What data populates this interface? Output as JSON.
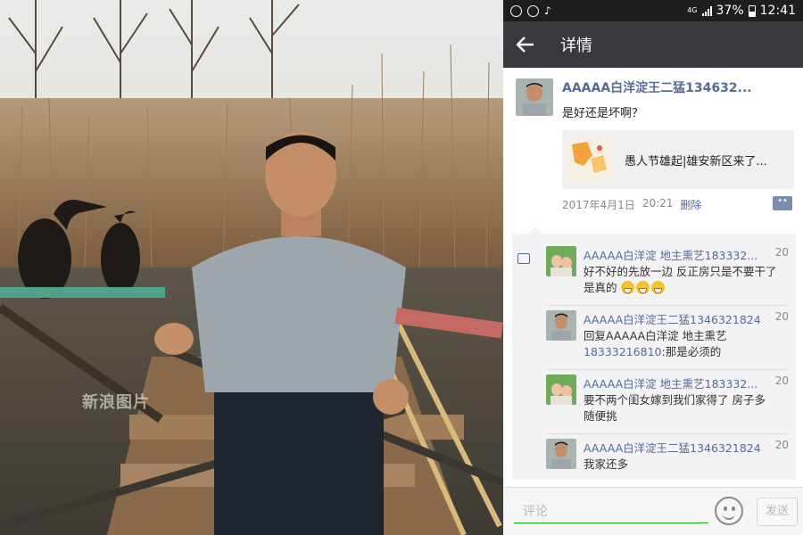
{
  "photo": {
    "watermark": "新浪图片"
  },
  "status_bar": {
    "left_icons": [
      "app-icon",
      "sync-icon",
      "tiktok-icon"
    ],
    "network": "4G",
    "battery": "37%",
    "time": "12:41"
  },
  "titlebar": {
    "back_icon": "back-arrow-icon",
    "title": "详情"
  },
  "post": {
    "username": "AAAAA白洋淀王二猛134632...",
    "text": "是好还是坏啊？",
    "link_title": "愚人节雄起|雄安新区来了...",
    "date": "2017年4月1日",
    "time": "20:21",
    "delete": "删除"
  },
  "comments": [
    {
      "name": "AAAAA白洋淀 地主熏艺183332...",
      "time": "20",
      "text": "好不好的先放一边 反正房只是不要干了是真的"
    },
    {
      "name": "AAAAA白洋淀王二猛1346321824",
      "time": "20",
      "text_prefix": "回复AAAAA白洋淀 地主熏艺",
      "phone": "18333216810",
      "text_suffix": ":那是必须的"
    },
    {
      "name": "AAAAA白洋淀 地主熏艺183332...",
      "time": "20",
      "text": "要不两个闺女嫁到我们家得了 房子多 随便挑"
    },
    {
      "name": "AAAAA白洋淀王二猛1346321824",
      "time": "20",
      "text": "我家还多"
    }
  ],
  "input": {
    "placeholder": "评论",
    "send": "发送"
  },
  "colors": {
    "link": "#576b95",
    "titlebar": "#393a3e",
    "accent": "#1aad19"
  }
}
